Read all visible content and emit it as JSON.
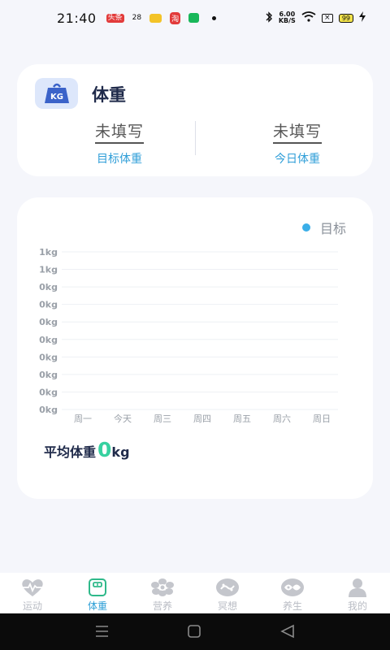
{
  "status_bar": {
    "time": "21:40",
    "app_badge_1": "头条",
    "mini_text": "28",
    "app_badge_2": "淘",
    "speed_value": "6.00",
    "speed_unit": "KB/S",
    "battery": "99"
  },
  "weight_card": {
    "badge": "KG",
    "title": "体重",
    "target_value": "未填写",
    "target_label": "目标体重",
    "today_value": "未填写",
    "today_label": "今日体重"
  },
  "chart_card": {
    "legend_label": "目标",
    "avg_label": "平均体重",
    "avg_value": "0",
    "avg_unit": "kg"
  },
  "chart_data": {
    "type": "line",
    "categories": [
      "周一",
      "今天",
      "周三",
      "周四",
      "周五",
      "周六",
      "周日"
    ],
    "y_tick_labels": [
      "1kg",
      "1kg",
      "0kg",
      "0kg",
      "0kg",
      "0kg",
      "0kg",
      "0kg",
      "0kg",
      "0kg"
    ],
    "series": [
      {
        "name": "目标",
        "values": [],
        "color": "#3aaee8"
      }
    ],
    "ylim": [
      0,
      1
    ],
    "grid": true,
    "legend": "top-right"
  },
  "tabs": [
    {
      "label": "运动",
      "icon": "heartbeat-icon",
      "active": false
    },
    {
      "label": "体重",
      "icon": "scale-icon",
      "active": true
    },
    {
      "label": "营养",
      "icon": "flower-icon",
      "active": false
    },
    {
      "label": "冥想",
      "icon": "meditation-icon",
      "active": false
    },
    {
      "label": "养生",
      "icon": "yin-yang-icon",
      "active": false
    },
    {
      "label": "我的",
      "icon": "person-icon",
      "active": false
    }
  ],
  "colors": {
    "accent": "#2b9ed6",
    "accent_green": "#37d1a0",
    "inactive": "#b9bcc4",
    "background": "#f5f6fb"
  }
}
